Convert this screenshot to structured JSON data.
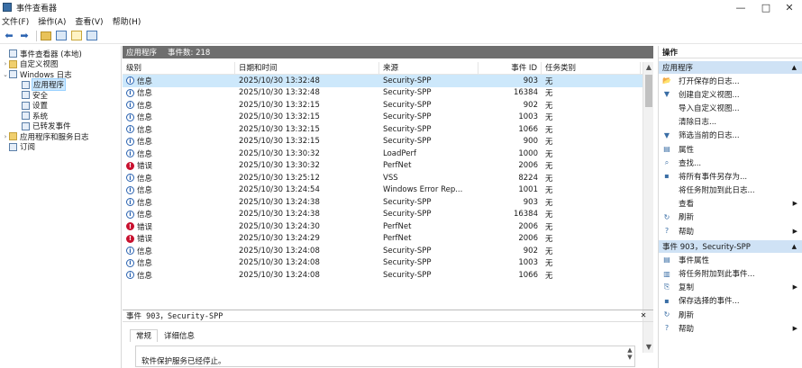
{
  "window": {
    "title": "事件查看器",
    "minimize": "—",
    "maximize": "□",
    "close": "✕"
  },
  "menu": [
    "文件(F)",
    "操作(A)",
    "查看(V)",
    "帮助(H)"
  ],
  "tree": [
    {
      "label": "事件查看器 (本地)",
      "indent": 0,
      "expander": ""
    },
    {
      "label": "自定义视图",
      "indent": 0,
      "expander": "›"
    },
    {
      "label": "Windows 日志",
      "indent": 0,
      "expander": "⌄"
    },
    {
      "label": "应用程序",
      "indent": 1,
      "expander": "",
      "selected": true
    },
    {
      "label": "安全",
      "indent": 1,
      "expander": ""
    },
    {
      "label": "设置",
      "indent": 1,
      "expander": ""
    },
    {
      "label": "系统",
      "indent": 1,
      "expander": ""
    },
    {
      "label": "已转发事件",
      "indent": 1,
      "expander": ""
    },
    {
      "label": "应用程序和服务日志",
      "indent": 0,
      "expander": "›"
    },
    {
      "label": "订阅",
      "indent": 0,
      "expander": ""
    }
  ],
  "center": {
    "log_name": "应用程序",
    "count_text": "事件数: 218",
    "columns": [
      "级别",
      "日期和时间",
      "来源",
      "事件 ID",
      "任务类别"
    ],
    "rows": [
      {
        "level": "信息",
        "type": "info",
        "date": "2025/10/30 13:32:48",
        "source": "Security-SPP",
        "id": "903",
        "cat": "无",
        "selected": true
      },
      {
        "level": "信息",
        "type": "info",
        "date": "2025/10/30 13:32:48",
        "source": "Security-SPP",
        "id": "16384",
        "cat": "无"
      },
      {
        "level": "信息",
        "type": "info",
        "date": "2025/10/30 13:32:15",
        "source": "Security-SPP",
        "id": "902",
        "cat": "无"
      },
      {
        "level": "信息",
        "type": "info",
        "date": "2025/10/30 13:32:15",
        "source": "Security-SPP",
        "id": "1003",
        "cat": "无"
      },
      {
        "level": "信息",
        "type": "info",
        "date": "2025/10/30 13:32:15",
        "source": "Security-SPP",
        "id": "1066",
        "cat": "无"
      },
      {
        "level": "信息",
        "type": "info",
        "date": "2025/10/30 13:32:15",
        "source": "Security-SPP",
        "id": "900",
        "cat": "无"
      },
      {
        "level": "信息",
        "type": "info",
        "date": "2025/10/30 13:30:32",
        "source": "LoadPerf",
        "id": "1000",
        "cat": "无"
      },
      {
        "level": "错误",
        "type": "error",
        "date": "2025/10/30 13:30:32",
        "source": "PerfNet",
        "id": "2006",
        "cat": "无"
      },
      {
        "level": "信息",
        "type": "info",
        "date": "2025/10/30 13:25:12",
        "source": "VSS",
        "id": "8224",
        "cat": "无"
      },
      {
        "level": "信息",
        "type": "info",
        "date": "2025/10/30 13:24:54",
        "source": "Windows Error Rep...",
        "id": "1001",
        "cat": "无"
      },
      {
        "level": "信息",
        "type": "info",
        "date": "2025/10/30 13:24:38",
        "source": "Security-SPP",
        "id": "903",
        "cat": "无"
      },
      {
        "level": "信息",
        "type": "info",
        "date": "2025/10/30 13:24:38",
        "source": "Security-SPP",
        "id": "16384",
        "cat": "无"
      },
      {
        "level": "错误",
        "type": "error",
        "date": "2025/10/30 13:24:30",
        "source": "PerfNet",
        "id": "2006",
        "cat": "无"
      },
      {
        "level": "错误",
        "type": "error",
        "date": "2025/10/30 13:24:29",
        "source": "PerfNet",
        "id": "2006",
        "cat": "无"
      },
      {
        "level": "信息",
        "type": "info",
        "date": "2025/10/30 13:24:08",
        "source": "Security-SPP",
        "id": "902",
        "cat": "无"
      },
      {
        "level": "信息",
        "type": "info",
        "date": "2025/10/30 13:24:08",
        "source": "Security-SPP",
        "id": "1003",
        "cat": "无"
      },
      {
        "level": "信息",
        "type": "info",
        "date": "2025/10/30 13:24:08",
        "source": "Security-SPP",
        "id": "1066",
        "cat": "无"
      }
    ]
  },
  "detail": {
    "title": "事件 903，Security-SPP",
    "tabs": [
      "常规",
      "详细信息"
    ],
    "message": "软件保护服务已经停止。"
  },
  "actions": {
    "header": "操作",
    "sections": [
      {
        "title": "应用程序",
        "items": [
          {
            "label": "打开保存的日志...",
            "icon": "📂"
          },
          {
            "label": "创建自定义视图...",
            "icon": "▼"
          },
          {
            "label": "导入自定义视图...",
            "icon": ""
          },
          {
            "label": "清除日志...",
            "icon": ""
          },
          {
            "label": "筛选当前的日志...",
            "icon": "▼"
          },
          {
            "label": "属性",
            "icon": "▤"
          },
          {
            "label": "查找...",
            "icon": "⌕"
          },
          {
            "label": "将所有事件另存为...",
            "icon": "▪"
          },
          {
            "label": "将任务附加到此日志...",
            "icon": ""
          },
          {
            "label": "查看",
            "icon": "",
            "more": true
          },
          {
            "label": "刷新",
            "icon": "↻"
          },
          {
            "label": "帮助",
            "icon": "?",
            "more": true
          }
        ]
      },
      {
        "title": "事件 903，Security-SPP",
        "items": [
          {
            "label": "事件属性",
            "icon": "▤"
          },
          {
            "label": "将任务附加到此事件...",
            "icon": "▥"
          },
          {
            "label": "复制",
            "icon": "⎘",
            "more": true
          },
          {
            "label": "保存选择的事件...",
            "icon": "▪"
          },
          {
            "label": "刷新",
            "icon": "↻"
          },
          {
            "label": "帮助",
            "icon": "?",
            "more": true
          }
        ]
      }
    ]
  }
}
